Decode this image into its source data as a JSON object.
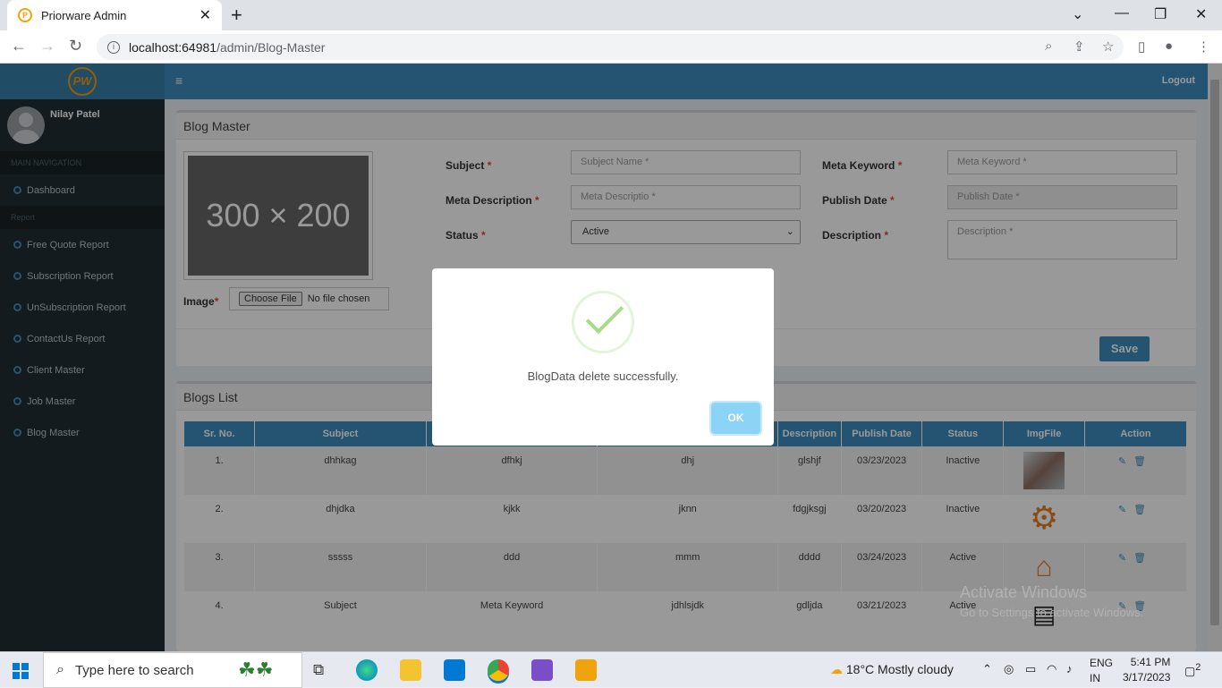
{
  "browser": {
    "tab_title": "Priorware Admin",
    "url_host": "localhost:64981",
    "url_path": "/admin/Blog-Master"
  },
  "sidebar": {
    "logo_text": "PW",
    "user_name": "Nilay Patel",
    "main_nav_header": "MAIN NAVIGATION",
    "report_header": "Report",
    "items": [
      {
        "label": "Dashboard"
      },
      {
        "label": "Free Quote Report"
      },
      {
        "label": "Subscription Report"
      },
      {
        "label": "UnSubscription Report"
      },
      {
        "label": "ContactUs Report"
      },
      {
        "label": "Client Master"
      },
      {
        "label": "Job Master"
      },
      {
        "label": "Blog Master"
      }
    ]
  },
  "header": {
    "logout": "Logout"
  },
  "form": {
    "title": "Blog Master",
    "image_placeholder": "300 × 200",
    "image_label": "Image",
    "choose_file": "Choose File",
    "no_file": "No file chosen",
    "subject_label": "Subject",
    "subject_placeholder": "Subject Name *",
    "meta_keyword_label": "Meta Keyword",
    "meta_keyword_placeholder": "Meta Keyword *",
    "meta_desc_label": "Meta Description",
    "meta_desc_placeholder": "Meta Descriptio *",
    "publish_date_label": "Publish Date",
    "publish_date_placeholder": "Publish Date *",
    "status_label": "Status",
    "status_value": "Active",
    "description_label": "Description",
    "description_placeholder": "Description *",
    "required_mark": "*",
    "save": "Save"
  },
  "blogs": {
    "title": "Blogs List",
    "columns": [
      "Sr. No.",
      "Subject",
      "",
      "",
      "Description",
      "Publish Date",
      "Status",
      "ImgFile",
      "Action"
    ],
    "rows": [
      {
        "sr": "1.",
        "subject": "dhhkag",
        "meta_keyword": "dfhkj",
        "meta_desc": "dhj",
        "description": "glshjf",
        "date": "03/23/2023",
        "status": "Inactive",
        "img": "photo"
      },
      {
        "sr": "2.",
        "subject": "dhjdka",
        "meta_keyword": "kjkk",
        "meta_desc": "jknn",
        "description": "fdgjksgj",
        "date": "03/20/2023",
        "status": "Inactive",
        "img": "gear-chart"
      },
      {
        "sr": "3.",
        "subject": "sssss",
        "meta_keyword": "ddd",
        "meta_desc": "mmm",
        "description": "dddd",
        "date": "03/24/2023",
        "status": "Active",
        "img": "bulb-house"
      },
      {
        "sr": "4.",
        "subject": "Subject",
        "meta_keyword": "Meta Keyword",
        "meta_desc": "jdhlsjdk",
        "description": "gdljda",
        "date": "03/21/2023",
        "status": "Active",
        "img": "books"
      }
    ]
  },
  "modal": {
    "message": "BlogData delete successfully.",
    "ok": "OK"
  },
  "watermark": {
    "line1": "Activate Windows",
    "line2": "Go to Settings to activate Windows."
  },
  "taskbar": {
    "search_placeholder": "Type here to search",
    "weather": "18°C  Mostly cloudy",
    "lang1": "ENG",
    "lang2": "IN",
    "time": "5:41 PM",
    "date": "3/17/2023",
    "notifications": "2"
  },
  "colors": {
    "primary": "#3c8dbc",
    "sidebar": "#222d32",
    "ok_button": "#8cd4f5",
    "success": "#a5dc86"
  }
}
